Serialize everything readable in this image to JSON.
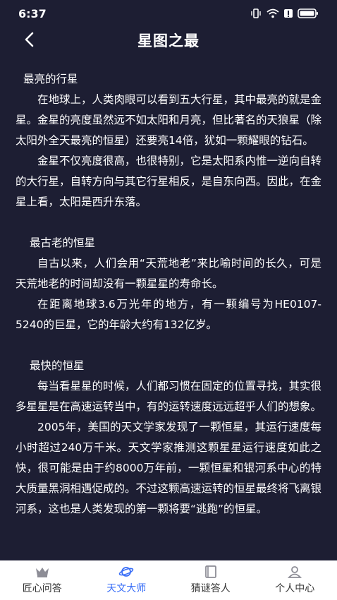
{
  "status": {
    "time": "6:37"
  },
  "nav": {
    "title": "星图之最"
  },
  "sections": [
    {
      "title": "最亮的行星",
      "paragraphs": [
        "在地球上，人类肉眼可以看到五大行星，其中最亮的就是金星。金星的亮度虽然远不如太阳和月亮，但比著名的天狼星（除太阳外全天最亮的恒星）还要亮14倍，犹如一颗耀眼的钻石。",
        "金星不仅亮度很高，也很特别，它是太阳系内惟一逆向自转的大行星，自转方向与其它行星相反，是自东向西。因此，在金星上看，太阳是西升东落。"
      ]
    },
    {
      "title": "最古老的恒星",
      "paragraphs": [
        "自古以来，人们会用“天荒地老”来比喻时间的长久，可是天荒地老的时间却没有一颗星星的寿命长。",
        "在距离地球3.6万光年的地方，有一颗编号为HE0107-5240的巨星，它的年龄大约有132亿岁。"
      ]
    },
    {
      "title": "最快的恒星",
      "paragraphs": [
        "每当看星星的时候，人们都习惯在固定的位置寻找，其实很多星星是在高速运转当中，有的运转速度远远超乎人们的想象。",
        "2005年，美国的天文学家发现了一颗恒星，其运行速度每小时超过240万千米。天文学家推测这颗星星运行速度如此之快，很可能是由于约8000万年前，一颗恒星和银河系中心的特大质量黑洞相遇促成的。不过这颗高速运转的恒星最终将飞离银河系，这也是人类发现的第一颗将要“逃跑”的恒星。"
      ]
    }
  ],
  "tabs": [
    {
      "label": "匠心问答",
      "icon": "crown-icon",
      "active": false
    },
    {
      "label": "天文大师",
      "icon": "planet-icon",
      "active": true
    },
    {
      "label": "猜谜答人",
      "icon": "book-icon",
      "active": false
    },
    {
      "label": "个人中心",
      "icon": "person-icon",
      "active": false
    }
  ],
  "colors": {
    "background": "#1d1e33",
    "accent": "#3a6ff7",
    "tabbar": "#ffffff"
  }
}
